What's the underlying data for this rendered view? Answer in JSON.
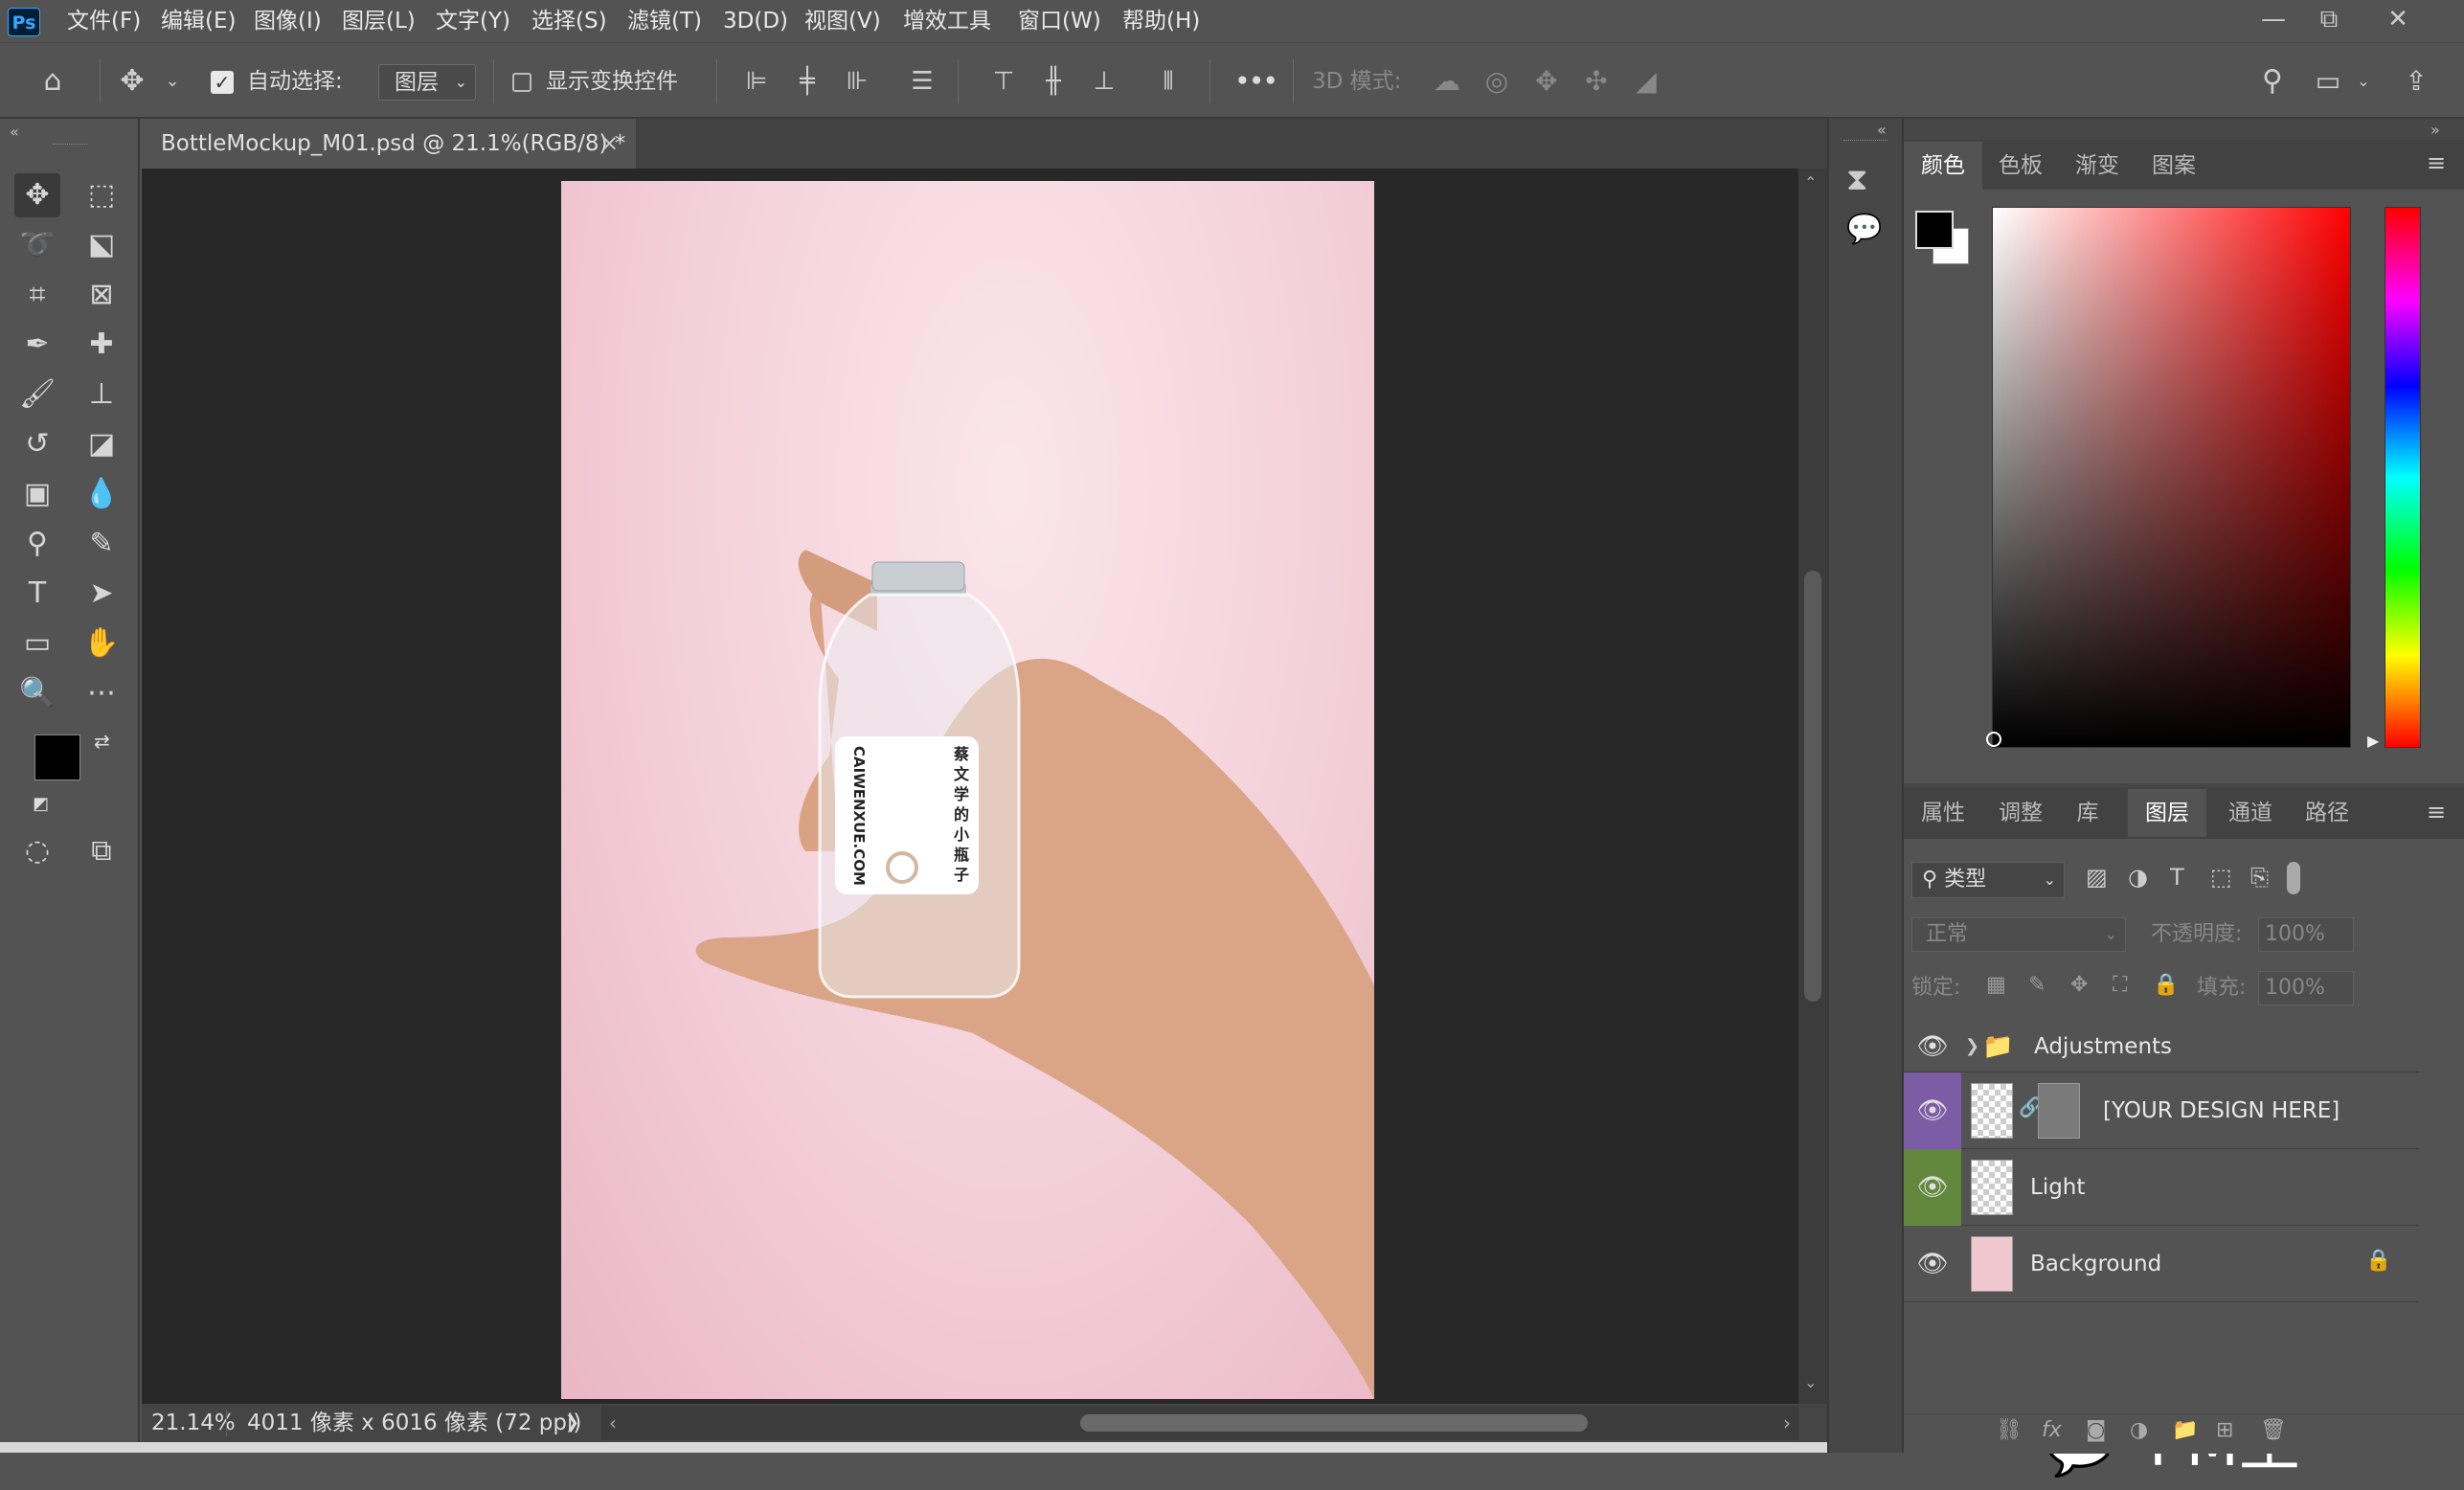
{
  "app": {
    "logo": "Ps"
  },
  "menu": [
    "文件(F)",
    "编辑(E)",
    "图像(I)",
    "图层(L)",
    "文字(Y)",
    "选择(S)",
    "滤镜(T)",
    "3D(D)",
    "视图(V)",
    "增效工具",
    "窗口(W)",
    "帮助(H)"
  ],
  "window_controls": {
    "minimize": "—",
    "restore": "⧉",
    "close": "✕"
  },
  "options": {
    "auto_select_label": "自动选择:",
    "auto_select_checked": true,
    "auto_select_value": "图层",
    "show_transform_label": "显示变换控件",
    "show_transform_checked": false,
    "more_label": "•••",
    "mode_3d_label": "3D 模式:"
  },
  "document": {
    "tab_title": "BottleMockup_M01.psd @ 21.1%(RGB/8) *",
    "tab_close": "×",
    "bottle_label_brand": "CAIWENXUE.COM",
    "bottle_label_cn": "蔡文学的小瓶子"
  },
  "status": {
    "zoom": "21.14%",
    "dimensions": "4011 像素 x 6016 像素 (72 ppi)",
    "arrow": "❯"
  },
  "color_panel": {
    "tabs": [
      "颜色",
      "色板",
      "渐变",
      "图案"
    ],
    "active_tab": 0,
    "foreground": "#000000",
    "background": "#ffffff"
  },
  "layers_panel": {
    "tabs": [
      "属性",
      "调整",
      "库",
      "图层",
      "通道",
      "路径"
    ],
    "active_tab": 3,
    "filter_label": "类型",
    "blend_mode": "正常",
    "opacity_label": "不透明度:",
    "opacity_value": "100%",
    "lock_label": "锁定:",
    "fill_label": "填充:",
    "fill_value": "100%",
    "layers": [
      {
        "name": "Adjustments",
        "type": "group",
        "color": "none",
        "locked": false
      },
      {
        "name": "[YOUR DESIGN HERE]",
        "type": "smart-object",
        "color": "#7d5ca6",
        "locked": false
      },
      {
        "name": "Light",
        "type": "smart-object",
        "color": "#62883d",
        "locked": false
      },
      {
        "name": "Background",
        "type": "image",
        "color": "none",
        "locked": true
      }
    ]
  },
  "watermark": {
    "text": "PM王"
  }
}
